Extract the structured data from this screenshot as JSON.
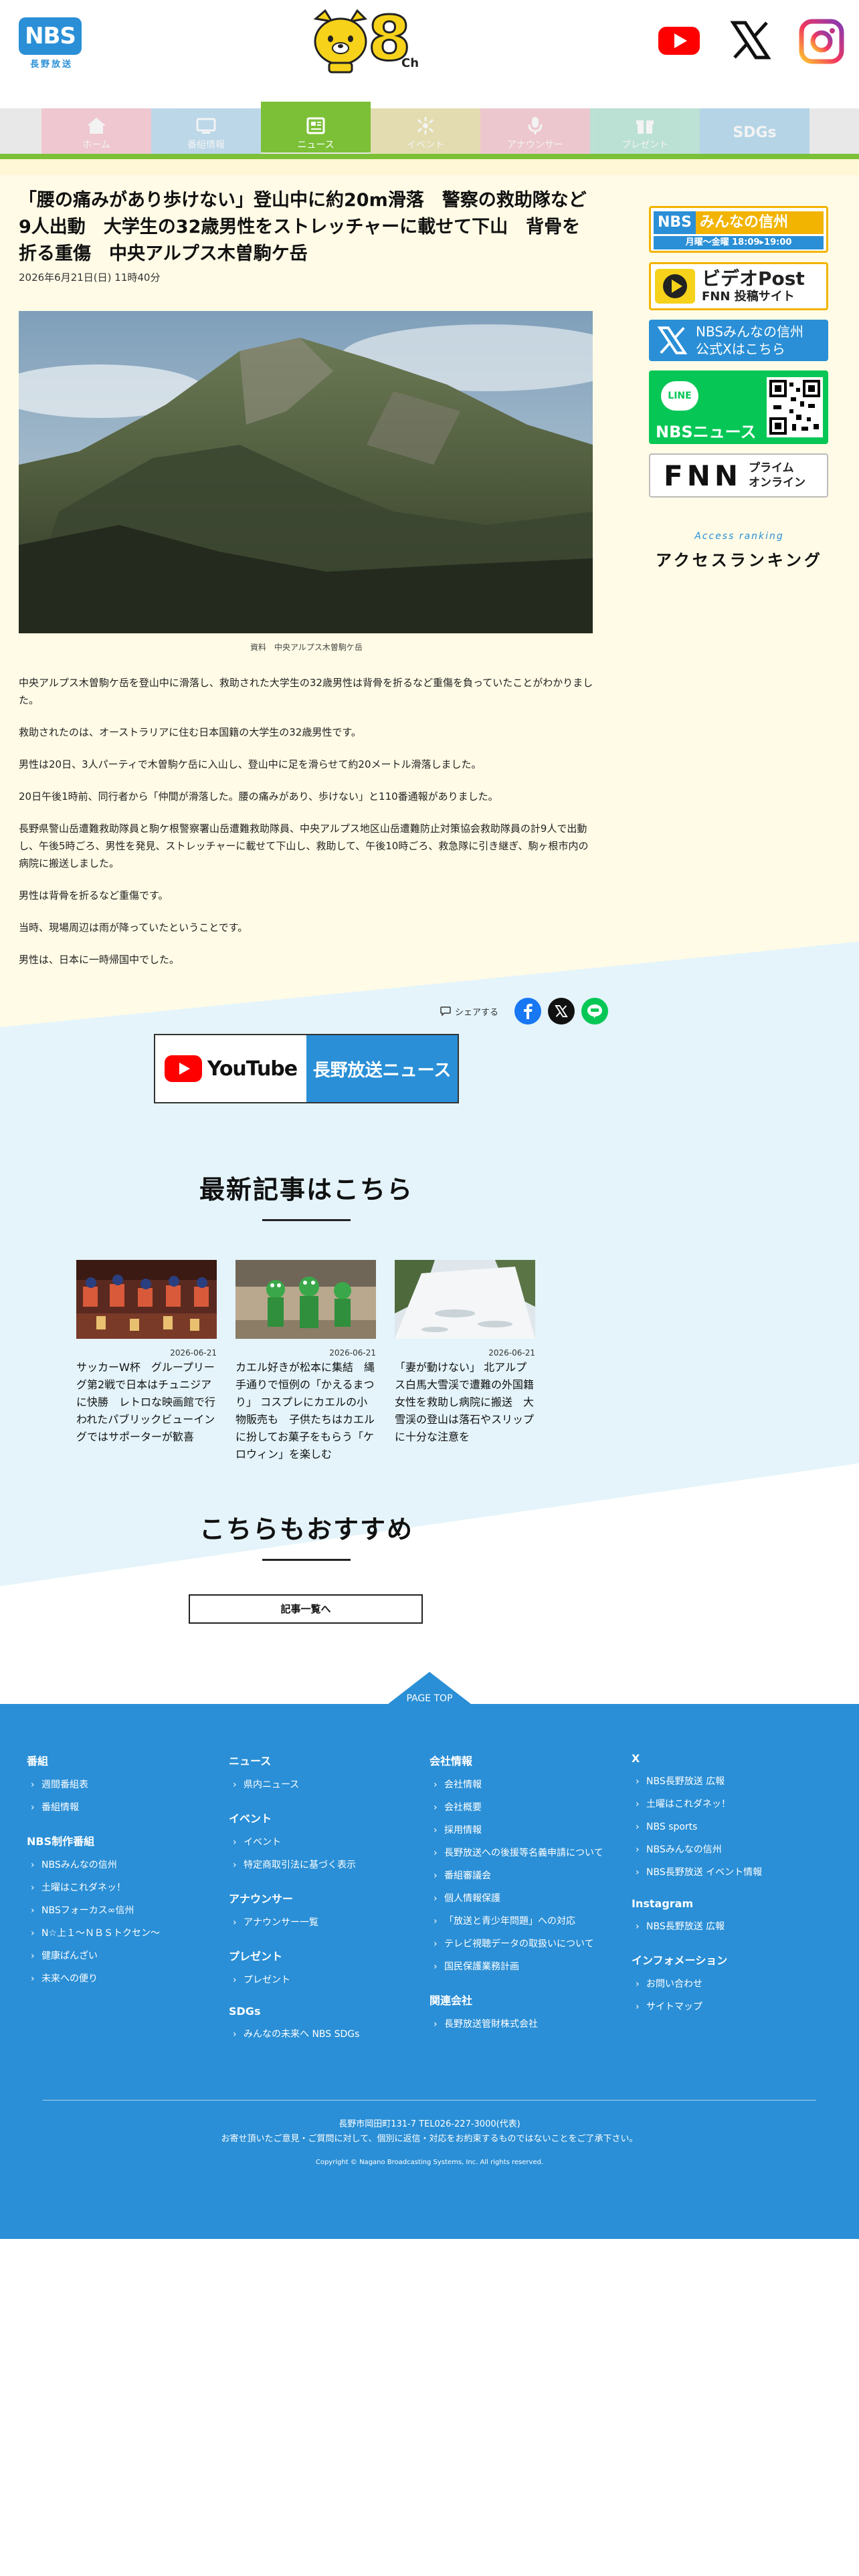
{
  "header": {
    "logo_text": "NBS",
    "logo_sub": "長野放送",
    "channel_mark": "8",
    "channel_suffix": "Ch"
  },
  "nav": {
    "tabs": [
      {
        "label": "ホーム",
        "icon": "home-icon",
        "color": "#f4a7b9"
      },
      {
        "label": "番組情報",
        "icon": "tv-icon",
        "color": "#8fc7e8"
      },
      {
        "label": "ニュース",
        "icon": "newspaper-icon",
        "color": "#7cc038",
        "active": true
      },
      {
        "label": "イベント",
        "icon": "event-icon",
        "color": "#e0d27a"
      },
      {
        "label": "アナウンサー",
        "icon": "microphone-icon",
        "color": "#f2a7b5"
      },
      {
        "label": "プレゼント",
        "icon": "gift-icon",
        "color": "#8fd9c2"
      },
      {
        "label": "SDGs",
        "icon": "sdgs-icon",
        "color": "#84c3e6"
      }
    ]
  },
  "article": {
    "headline": "「腰の痛みがあり歩けない」登山中に約20m滑落　警察の救助隊など9人出動　大学生の32歳男性をストレッチャーに載せて下山　背骨を折る重傷　中央アルプス木曽駒ケ岳",
    "date": "2026年6月21日(日) 11時40分",
    "caption": "資料　中央アルプス木曽駒ケ岳",
    "paragraphs": [
      "中央アルプス木曽駒ケ岳を登山中に滑落し、救助された大学生の32歳男性は背骨を折るなど重傷を負っていたことがわかりました。",
      "救助されたのは、オーストラリアに住む日本国籍の大学生の32歳男性です。",
      "男性は20日、3人パーティで木曽駒ケ岳に入山し、登山中に足を滑らせて約20メートル滑落しました。",
      "20日午後1時前、同行者から「仲間が滑落した。腰の痛みがあり、歩けない」と110番通報がありました。",
      "長野県警山岳遭難救助隊員と駒ケ根警察署山岳遭難救助隊員、中央アルプス地区山岳遭難防止対策協会救助隊員の計9人で出動し、午後5時ごろ、男性を発見、ストレッチャーに載せて下山し、救助して、午後10時ごろ、救急隊に引き継ぎ、駒ヶ根市内の病院に搬送しました。",
      "男性は背骨を折るなど重傷です。",
      "当時、現場周辺は雨が降っていたということです。",
      "男性は、日本に一時帰国中でした。"
    ]
  },
  "sidebar": {
    "banner1": {
      "brand": "NBS",
      "title": "みんなの信州",
      "sub": "月曜～金曜 18:09▸19:00"
    },
    "banner2": {
      "title": "ビデオPost",
      "sub": "FNN 投稿サイト"
    },
    "banner3": {
      "line1": "NBSみんなの信州",
      "line2": "公式Xはこちら"
    },
    "banner4": {
      "badge": "LINE",
      "title": "NBSニュース"
    },
    "banner5": {
      "logo": "FNN",
      "line1": "プライム",
      "line2": "オンライン"
    },
    "ranking_en": "Access ranking",
    "ranking_jp": "アクセスランキング"
  },
  "share": {
    "label": "シェアする"
  },
  "youtube_banner": {
    "brand": "YouTube",
    "channel": "長野放送ニュース"
  },
  "latest": {
    "title": "最新記事はこちら",
    "items": [
      {
        "date": "2026-06-21",
        "title": "サッカーW杯　グループリーグ第2戦で日本はチュニジアに快勝　レトロな映画館で行われたパブリックビューイングではサポーターが歓喜"
      },
      {
        "date": "2026-06-21",
        "title": "カエル好きが松本に集結　縄手通りで恒例の「かえるまつり」 コスプレにカエルの小物販売も　子供たちはカエルに扮してお菓子をもらう「ケロウィン」を楽しむ"
      },
      {
        "date": "2026-06-21",
        "title": "「妻が動けない」 北アルプス白馬大雪渓で遭難の外国籍女性を救助し病院に搬送　大雪渓の登山は落石やスリップに十分な注意を"
      }
    ]
  },
  "recommend": {
    "title": "こちらもおすすめ"
  },
  "more_button": "記事一覧へ",
  "page_top": "PAGE TOP",
  "footer": {
    "columns": [
      [
        {
          "head": "番組",
          "items": [
            "週間番組表",
            "番組情報"
          ]
        },
        {
          "head": "NBS制作番組",
          "items": [
            "NBSみんなの信州",
            "土曜はこれダネッ！",
            "NBSフォーカス∞信州",
            "N☆上１～ＮＢＳトクセン～",
            "健康ぱんざい",
            "未来への便り"
          ]
        }
      ],
      [
        {
          "head": "ニュース",
          "items": [
            "県内ニュース"
          ]
        },
        {
          "head": "イベント",
          "items": [
            "イベント",
            "特定商取引法に基づく表示"
          ]
        },
        {
          "head": "アナウンサー",
          "items": [
            "アナウンサー一覧"
          ]
        },
        {
          "head": "プレゼント",
          "items": [
            "プレゼント"
          ]
        },
        {
          "head": "SDGs",
          "items": [
            "みんなの未来へ NBS SDGs"
          ]
        }
      ],
      [
        {
          "head": "会社情報",
          "items": [
            "会社情報",
            "会社概要",
            "採用情報",
            "長野放送への後援等名義申請について",
            "番組審議会",
            "個人情報保護",
            "「放送と青少年問題」への対応",
            "テレビ視聴データの取扱いについて",
            "国民保護業務計画"
          ]
        },
        {
          "head": "関連会社",
          "items": [
            "長野放送管財株式会社"
          ]
        }
      ],
      [
        {
          "head": "X",
          "items": [
            "NBS長野放送 広報",
            "土曜はこれダネッ！",
            "NBS sports",
            "NBSみんなの信州",
            "NBS長野放送 イベント情報"
          ]
        },
        {
          "head": "Instagram",
          "items": [
            "NBS長野放送 広報"
          ]
        },
        {
          "head": "インフォメーション",
          "items": [
            "お問い合わせ",
            "サイトマップ"
          ]
        }
      ]
    ],
    "address": "長野市岡田町131-7 TEL026-227-3000(代表)",
    "notice": "お寄せ頂いたご意見・ご質問に対して、個別に返信・対応をお約束するものではないことをご了承下さい。",
    "copyright": "Copyright © Nagano Broadcasting Systems, Inc. All rights reserved."
  },
  "colors": {
    "brand_blue": "#2a8fd6",
    "news_green": "#7cc038",
    "cream": "#fffbe6",
    "light_blue": "#e4f4fa"
  }
}
